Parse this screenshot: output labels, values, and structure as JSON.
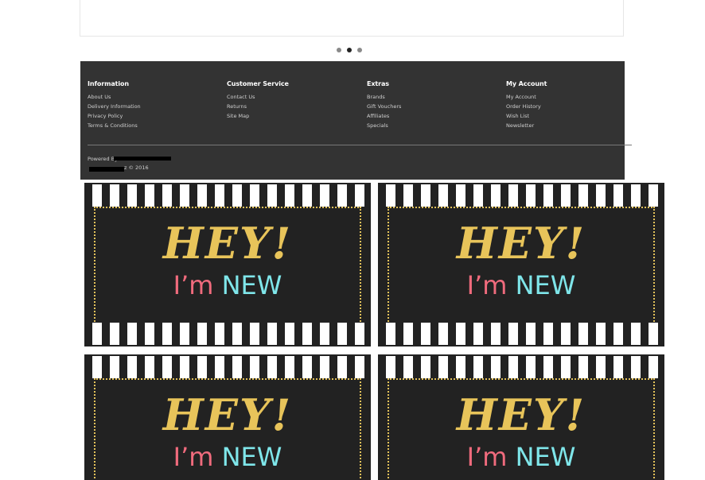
{
  "carousel": {
    "dots": 3,
    "active_index": 1
  },
  "footer": {
    "columns": [
      {
        "title": "Information",
        "links": [
          "About Us",
          "Delivery Information",
          "Privacy Policy",
          "Terms & Conditions"
        ]
      },
      {
        "title": "Customer Service",
        "links": [
          "Contact Us",
          "Returns",
          "Site Map"
        ]
      },
      {
        "title": "Extras",
        "links": [
          "Brands",
          "Gift Vouchers",
          "Affiliates",
          "Specials"
        ]
      },
      {
        "title": "My Account",
        "links": [
          "My Account",
          "Order History",
          "Wish List",
          "Newsletter"
        ]
      }
    ],
    "powered_label": "Powered By",
    "copyright_suffix": "z © 2016"
  },
  "banners": {
    "headline": "HEY!",
    "im": "I’m",
    "new": "NEW"
  },
  "colors": {
    "footer_bg": "#333333",
    "banner_bg": "#222222",
    "gold": "#e8c45a",
    "pink": "#f06b7d",
    "cyan": "#7fe6ea"
  }
}
